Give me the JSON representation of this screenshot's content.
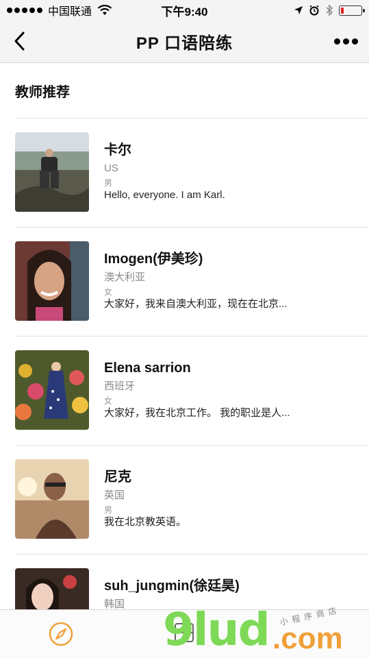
{
  "status_bar": {
    "carrier": "中国联通",
    "time": "下午9:40",
    "battery_level": 0.15
  },
  "nav": {
    "title": "PP 口语陪练"
  },
  "section": {
    "title": "教师推荐"
  },
  "teachers": [
    {
      "name": "卡尔",
      "country": "US",
      "gender": "男",
      "intro": "Hello, everyone. I am Karl."
    },
    {
      "name": "Imogen(伊美珍)",
      "country": "澳大利亚",
      "gender": "女",
      "intro": "大家好，我来自澳大利亚，现在在北京..."
    },
    {
      "name": "Elena sarrion",
      "country": "西班牙",
      "gender": "女",
      "intro": "大家好，我在北京工作。 我的职业是人..."
    },
    {
      "name": "尼克",
      "country": "英国",
      "gender": "男",
      "intro": "我在北京教英语。"
    },
    {
      "name": "suh_jungmin(徐廷昊)",
      "country": "韩国",
      "gender": "",
      "intro": ""
    }
  ],
  "watermark": {
    "big": "9lud",
    "com": ".com",
    "small": "小程序商店"
  },
  "colors": {
    "tab_active": "#f0a03a",
    "battery_low": "#e0231c"
  }
}
